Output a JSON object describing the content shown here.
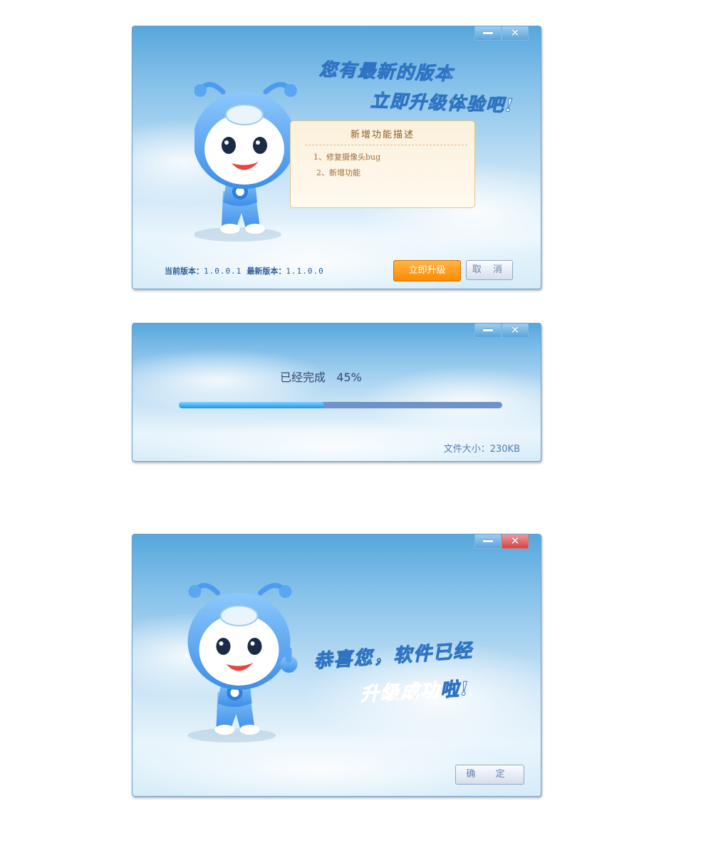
{
  "update_dialog": {
    "headline_line1": "您有最新的版本",
    "headline_line2": "立即升级体验吧!",
    "notice": {
      "title": "新增功能描述",
      "items": [
        "1、修复摄像头bug",
        "2、新增功能"
      ]
    },
    "current_version_label": "当前版本：",
    "current_version": "1.0.0.1",
    "latest_version_label": "最新版本：",
    "latest_version": "1.1.0.0",
    "upgrade_button": "立即升级",
    "cancel_button": "取 消"
  },
  "progress_dialog": {
    "status_label": "已经完成",
    "percent_text": "45%",
    "progress_fraction": 0.45,
    "file_size": "文件大小：230KB"
  },
  "success_dialog": {
    "message_line1": "恭喜您，软件已经",
    "message_line2_accent": "升级成功",
    "message_line2_tail": "啦!",
    "ok_button": "确 定"
  },
  "icons": {
    "minimize": "minimize-icon",
    "close": "close-icon",
    "mascot": "ant-mascot-icon"
  },
  "colors": {
    "accent_orange": "#ff8a00",
    "close_red": "#d84343",
    "progress_fill": "#1e94e8",
    "progress_track": "#6f93c8"
  }
}
